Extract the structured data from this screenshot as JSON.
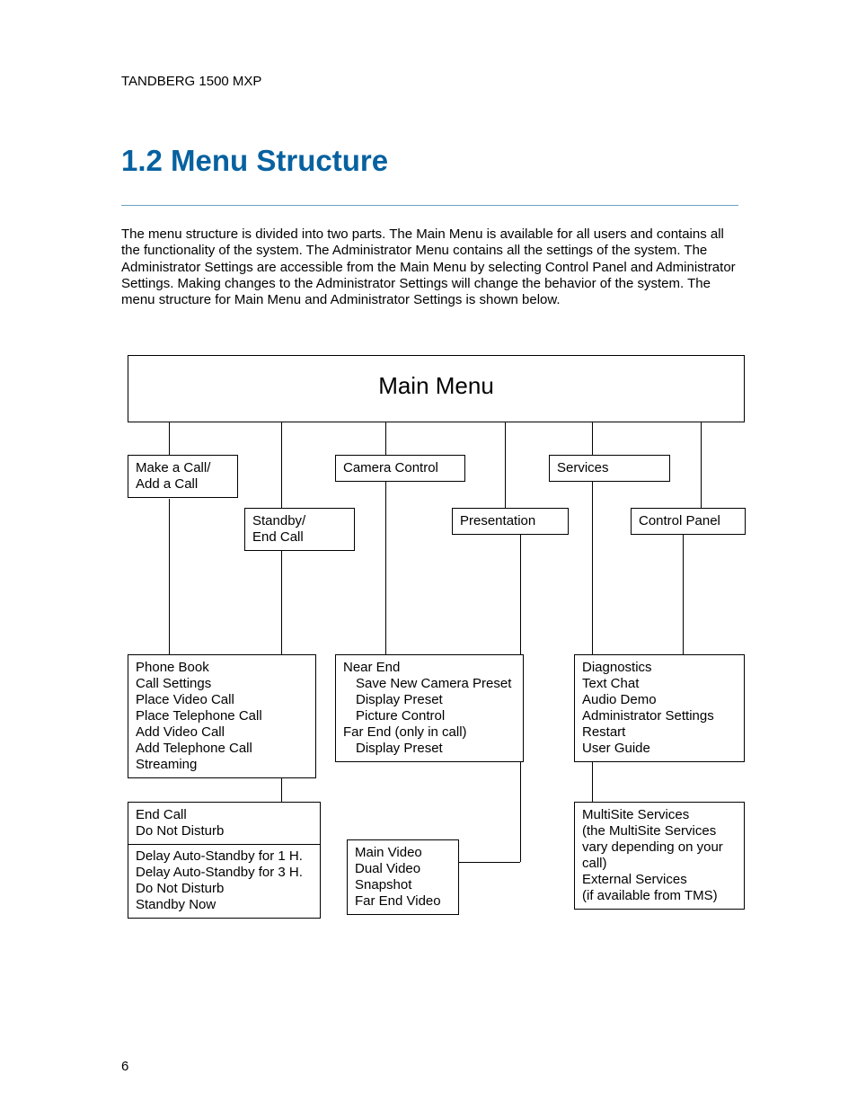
{
  "header": "TANDBERG 1500 MXP",
  "title": "1.2 Menu Structure",
  "body": "The menu structure is divided into two parts. The Main Menu is available for all users and contains all the functionality of the system. The Administrator Menu contains all the settings of the system. The Administrator Settings are accessible from the Main Menu by selecting Control Panel and Administrator Settings. Making changes to the Administrator Settings will change the behavior of the system. The menu structure for Main Menu and Administrator Settings is shown below.",
  "page_num": "6",
  "diagram": {
    "main_title": "Main Menu",
    "row1": {
      "make_call": "Make a Call/\nAdd a Call",
      "standby": "Standby/\nEnd Call",
      "camera": "Camera Control",
      "presentation": "Presentation",
      "services": "Services",
      "control_panel": "Control Panel"
    },
    "col1_a": [
      "Phone Book",
      "Call Settings",
      "Place Video Call",
      "Place Telephone Call",
      "Add Video Call",
      "Add Telephone Call",
      "Streaming"
    ],
    "col1_b_top": [
      "End Call",
      "Do Not Disturb"
    ],
    "col1_b_bot": [
      "Delay Auto-Standby for 1 H.",
      "Delay Auto-Standby for 3 H.",
      "Do Not Disturb",
      "Standby Now"
    ],
    "col2_a_head": "Near End",
    "col2_a_sub": [
      "Save New Camera Preset",
      "Display Preset",
      "Picture Control"
    ],
    "col2_a_head2": "Far End (only in call)",
    "col2_a_sub2": [
      "Display Preset"
    ],
    "col2_b": [
      "Main Video",
      "Dual Video",
      "Snapshot",
      "Far End Video"
    ],
    "col3_a": [
      "Diagnostics",
      "Text Chat",
      "Audio Demo",
      "Administrator Settings",
      "Restart",
      "User Guide"
    ],
    "col3_b": [
      "MultiSite Services",
      "(the MultiSite Services vary depending on your call)",
      "External Services",
      "(if available from TMS)"
    ]
  }
}
